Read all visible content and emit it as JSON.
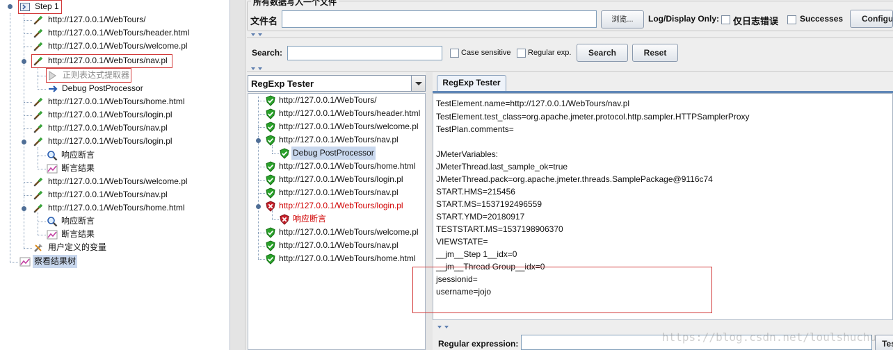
{
  "tree": {
    "step": "Step 1",
    "items": [
      "http://127.0.0.1/WebTours/",
      "http://127.0.0.1/WebTours/header.html",
      "http://127.0.0.1/WebTours/welcome.pl",
      "http://127.0.0.1/WebTours/nav.pl",
      "正则表达式提取器",
      "Debug PostProcessor",
      "http://127.0.0.1/WebTours/home.html",
      "http://127.0.0.1/WebTours/login.pl",
      "http://127.0.0.1/WebTours/nav.pl",
      "http://127.0.0.1/WebTours/login.pl",
      "响应断言",
      "断言结果",
      "http://127.0.0.1/WebTours/welcome.pl",
      "http://127.0.0.1/WebTours/nav.pl",
      "http://127.0.0.1/WebTours/home.html",
      "响应断言",
      "断言结果",
      "用户定义的变量",
      "察看结果树"
    ]
  },
  "file_section": {
    "title": "所有数据写入一个文件",
    "filename_label": "文件名",
    "browse_label": "浏览...",
    "log_display_label": "Log/Display Only:",
    "errors_only_label": "仅日志错误",
    "successes_label": "Successes",
    "configure_label": "Configure"
  },
  "search": {
    "label": "Search:",
    "case_sensitive": "Case sensitive",
    "regular_exp": "Regular exp.",
    "search_button": "Search",
    "reset_button": "Reset"
  },
  "renderer": {
    "selected": "RegExp Tester"
  },
  "results": [
    "http://127.0.0.1/WebTours/",
    "http://127.0.0.1/WebTours/header.html",
    "http://127.0.0.1/WebTours/welcome.pl",
    "http://127.0.0.1/WebTours/nav.pl",
    "Debug PostProcessor",
    "http://127.0.0.1/WebTours/home.html",
    "http://127.0.0.1/WebTours/login.pl",
    "http://127.0.0.1/WebTours/nav.pl",
    "http://127.0.0.1/WebTours/login.pl",
    "响应断言",
    "http://127.0.0.1/WebTours/welcome.pl",
    "http://127.0.0.1/WebTours/nav.pl",
    "http://127.0.0.1/WebTours/home.html"
  ],
  "tester": {
    "tab_label": "RegExp Tester",
    "lines": [
      "TestElement.name=http://127.0.0.1/WebTours/nav.pl",
      "TestElement.test_class=org.apache.jmeter.protocol.http.sampler.HTTPSamplerProxy",
      "TestPlan.comments=",
      "",
      "JMeterVariables:",
      "JMeterThread.last_sample_ok=true",
      "JMeterThread.pack=org.apache.jmeter.threads.SamplePackage@9116c74",
      "START.HMS=215456",
      "START.MS=1537192496559",
      "START.YMD=20180917",
      "TESTSTART.MS=1537198906370",
      "VIEWSTATE=",
      "__jm__Step 1__idx=0",
      "__jm__Thread Group__idx=0",
      "jsessionid=",
      "username=jojo"
    ],
    "regex_label": "Regular expression:",
    "test_button": "Tes"
  },
  "watermark": "https://blog.csdn.net/loulshuchu",
  "colors": {
    "selection": "#c9d8ee",
    "highlight_box": "#d33b3b",
    "failure_text": "#d00000",
    "success_icon": "#2aa22a",
    "failure_icon": "#c8202a"
  }
}
